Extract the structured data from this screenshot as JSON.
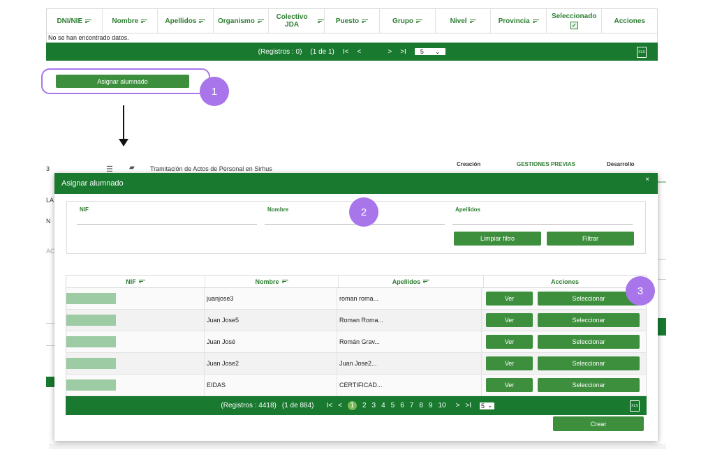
{
  "top_table": {
    "columns": [
      {
        "label": "DNI/NIE",
        "sortable": true
      },
      {
        "label": "Nombre",
        "sortable": true
      },
      {
        "label": "Apellidos",
        "sortable": true
      },
      {
        "label": "Organismo",
        "sortable": true
      },
      {
        "label": "Colectivo JDA",
        "sortable": true
      },
      {
        "label": "Puesto",
        "sortable": true
      },
      {
        "label": "Grupo",
        "sortable": true
      },
      {
        "label": "Nivel",
        "sortable": true
      },
      {
        "label": "Provincia",
        "sortable": true
      },
      {
        "label": "Seleccionado",
        "sortable": false
      },
      {
        "label": "Acciones",
        "sortable": false
      }
    ],
    "empty_message": "No se han encontrado datos.",
    "pager": {
      "records": "(Registros : 0)",
      "page_info": "(1 de 1)",
      "first": "I<",
      "prev": "<",
      "next": ">",
      "last": ">I",
      "page_size": "5"
    }
  },
  "assign_button": {
    "label": "Asignar alumnado"
  },
  "steps": {
    "one": "1",
    "two": "2",
    "three": "3"
  },
  "background_page": {
    "row_title": "Tramitación de Actos de Personal en Sirhus",
    "creacion": "Creación",
    "gestiones": "GESTIONES PREVIAS",
    "desarrollo": "Desarrollo",
    "frag_1": "3",
    "frag_2": "LA",
    "frag_3": "N",
    "frag_4": "AC"
  },
  "modal": {
    "title": "Asignar alumnado",
    "close": "×",
    "filters": {
      "nif_label": "NIF",
      "nombre_label": "Nombre",
      "apellidos_label": "Apellidos",
      "clear_label": "Limpiar filtro",
      "filter_label": "Filtrar"
    },
    "table": {
      "headers": [
        "NIF",
        "Nombre",
        "Apellidos",
        "Acciones"
      ],
      "rows": [
        {
          "nombre": "juanjose3",
          "apellidos": "roman roma..."
        },
        {
          "nombre": "Juan Jose5",
          "apellidos": "Roman Roma..."
        },
        {
          "nombre": "Juan José",
          "apellidos": "Román Grav..."
        },
        {
          "nombre": "Juan Jose2",
          "apellidos": "Juan Jose2..."
        },
        {
          "nombre": "EIDAS",
          "apellidos": "CERTIFICAD..."
        }
      ],
      "view_label": "Ver",
      "select_label": "Seleccionar"
    },
    "pager": {
      "records": "(Registros : 4418)",
      "page_info": "(1 de 884)",
      "first": "I<",
      "prev": "<",
      "pages": [
        "1",
        "2",
        "3",
        "4",
        "5",
        "6",
        "7",
        "8",
        "9",
        "10"
      ],
      "next": ">",
      "last": ">I",
      "page_size": "5"
    },
    "create_label": "Crear"
  },
  "colors": {
    "primary": "#19792f",
    "button": "#3d8f3d",
    "accent": "#a875ea",
    "nif_mask": "#9dcba4"
  }
}
